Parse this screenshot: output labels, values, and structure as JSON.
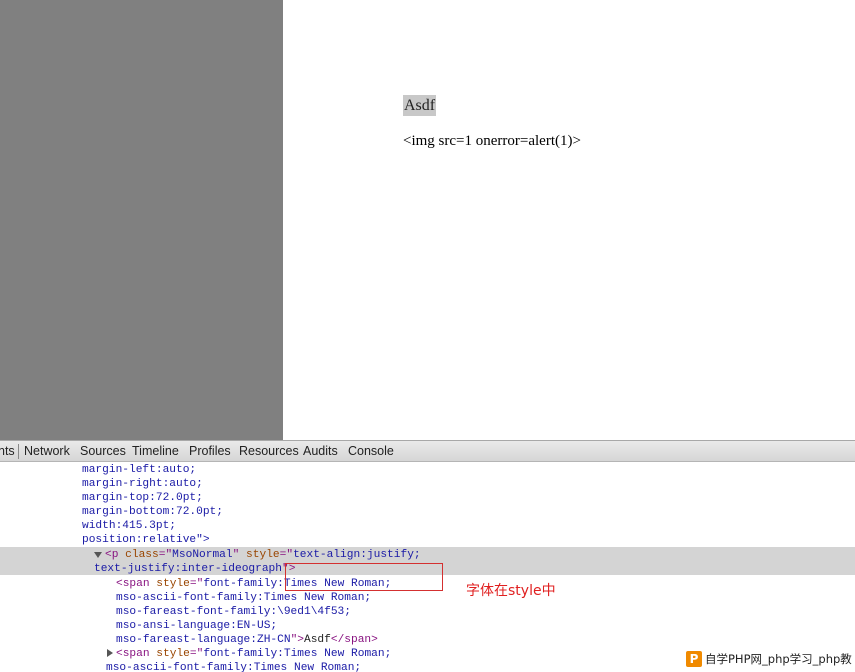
{
  "page": {
    "line1": "Asdf",
    "line2": "<img src=1 onerror=alert(1)>"
  },
  "devtools": {
    "tabs": [
      "nts",
      "Network",
      "Sources",
      "Timeline",
      "Profiles",
      "Resources",
      "Audits",
      "Console"
    ],
    "code": {
      "l1": "margin-left:auto;",
      "l2": "margin-right:auto;",
      "l3": "margin-top:72.0pt;",
      "l4": "margin-bottom:72.0pt;",
      "l5": "width:415.3pt;",
      "l6": "position:relative\">",
      "p_open": "<p",
      "p_class_attr": "class",
      "p_eq1": "=\"",
      "p_class_val": "MsoNormal",
      "p_q1": "\"",
      "p_style_attr": "style",
      "p_eq2": "=\"",
      "p_style_val": "text-align:justify;",
      "p_cont": "text-justify:inter-ideograph",
      "p_close": "\">",
      "span_open": "<span",
      "span_style_attr": "style",
      "span_eq": "=\"",
      "span_style_val": "font-family:Times New Roman;",
      "s2": "mso-ascii-font-family:Times New Roman;",
      "s3": "mso-fareast-font-family:\\9ed1\\4f53;",
      "s4": "mso-ansi-language:EN-US;",
      "s5_val": "mso-fareast-language:ZH-CN",
      "s5_close": "\">",
      "s5_text": "Asdf",
      "s5_end": "</span>",
      "span2_open": "<span",
      "span2_style_attr": "style",
      "span2_eq": "=\"",
      "span2_val": "font-family:Times New Roman;",
      "l_last": "mso-ascii-font-family:Times New Roman;"
    }
  },
  "annotation": {
    "note": "字体在style中"
  },
  "watermark": {
    "logo": "P",
    "text": "自学PHP网_php学习_php教"
  },
  "colors": {
    "tag": "#881280",
    "attr": "#994500",
    "value": "#1a1aa6",
    "annotation": "#e02020",
    "highlight": "#d4d4d4"
  }
}
